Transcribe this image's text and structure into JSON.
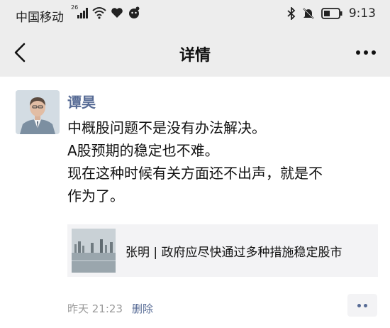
{
  "status_bar": {
    "carrier": "中国移动",
    "network": "26",
    "time": "9:13",
    "icons": [
      "signal-icon",
      "wifi-icon",
      "heart-rate-icon",
      "app-icon",
      "bluetooth-icon",
      "mute-bell-icon",
      "battery-icon"
    ]
  },
  "nav": {
    "title": "详情",
    "back_icon": "chevron-left-icon",
    "more_icon": "more-dots-icon"
  },
  "post": {
    "author": "谭昊",
    "content_lines": [
      "中概股问题不是没有办法解决。",
      "A股预期的稳定也不难。",
      "现在这种时候有关方面还不出声，就是不",
      "作为了。"
    ],
    "link": {
      "title": "张明 | 政府应尽快通过多种措施稳定股市"
    },
    "time": "昨天 21:23",
    "delete_label": "删除"
  },
  "colors": {
    "header_bg": "#ededed",
    "link_blue": "#576b95",
    "meta_gray": "#9a9a9a",
    "card_bg": "#f3f3f5"
  }
}
